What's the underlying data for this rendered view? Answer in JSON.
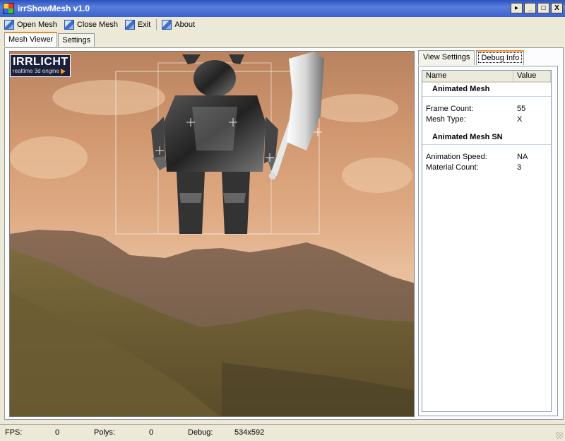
{
  "window": {
    "title": "irrShowMesh v1.0",
    "controls": [
      "▸",
      "_",
      "□",
      "X"
    ]
  },
  "toolbar": {
    "items": [
      {
        "label": "Open Mesh",
        "icon": "open-mesh-icon"
      },
      {
        "label": "Close Mesh",
        "icon": "close-mesh-icon"
      },
      {
        "label": "Exit",
        "icon": "exit-icon"
      },
      {
        "label": "About",
        "icon": "about-icon"
      }
    ]
  },
  "tabs": {
    "main": [
      "Mesh Viewer",
      "Settings"
    ],
    "active": "Mesh Viewer"
  },
  "viewport": {
    "logo_main": "IRRLICHT",
    "logo_sub": "realtime 3d engine"
  },
  "right_panel": {
    "tabs": [
      "View Settings",
      "Debug Info"
    ],
    "active": "Debug Info",
    "list": {
      "columns": [
        "Name",
        "Value"
      ],
      "groups": [
        {
          "title": "Animated Mesh",
          "rows": [
            {
              "name": "Frame Count:",
              "value": "55"
            },
            {
              "name": "Mesh Type:",
              "value": "X"
            }
          ]
        },
        {
          "title": "Animated Mesh SN",
          "rows": [
            {
              "name": "Animation Speed:",
              "value": "NA"
            },
            {
              "name": "Material Count:",
              "value": "3"
            }
          ]
        }
      ]
    }
  },
  "statusbar": {
    "fps_label": "FPS:",
    "fps_value": "0",
    "polys_label": "Polys:",
    "polys_value": "0",
    "debug_label": "Debug:",
    "debug_value": "534x592"
  },
  "colors": {
    "titlebar": "#2a52be",
    "tab_accent": "#e68b2c",
    "sky": "#dfab84"
  }
}
